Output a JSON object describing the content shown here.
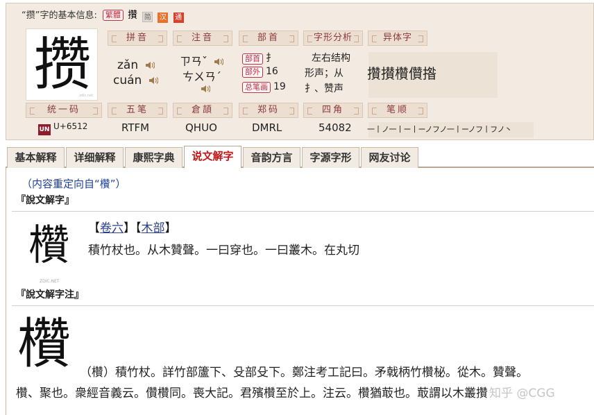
{
  "info": {
    "title_prefix": "“攒”字的基本信息:",
    "trad_tag": "繁體",
    "trad_char": "攢",
    "icon_grey": "简",
    "icon_orange": "汉",
    "icon_red": "通",
    "big_char": "攒",
    "big_char_watermark": "zdic.net"
  },
  "headers": {
    "pinyin": "拼音",
    "zhuyin": "注音",
    "bushou": "部首",
    "zixing": "字形分析",
    "yiti": "异体字",
    "tongyi": "统一码",
    "wubi": "五笔",
    "cangjie": "倉頡",
    "zhengma": "郑码",
    "sijiao": "四角",
    "bishun": "笔顺"
  },
  "values": {
    "pinyin_1": "zǎn",
    "pinyin_2": "cuán",
    "zhuyin_1": "ㄗㄢˇ",
    "zhuyin_2": "ㄘㄨㄢˊ",
    "bushou_label": "部首",
    "bushou_value": "扌",
    "buwai_label": "部外",
    "buwai_value": "16",
    "zongbihua_label": "总笔画",
    "zongbihua_value": "19",
    "zixing_1": "左右结构",
    "zixing_2": "形声；从",
    "zixing_3": "扌、赞声",
    "yiti": "攢攅欑儹揝",
    "unicode_logo": "UN",
    "unicode": "U+6512",
    "wubi": "RTFM",
    "cangjie": "QHUO",
    "zhengma": "DMRL",
    "sijiao": "54082",
    "bishun": "一丨ノ一丨ー丨ーノフノ一丨ーノフ丨フノ丶"
  },
  "tabs": [
    {
      "label": "基本解释"
    },
    {
      "label": "详细解释"
    },
    {
      "label": "康熙字典"
    },
    {
      "label": "说文解字",
      "active": true
    },
    {
      "label": "音韵方言"
    },
    {
      "label": "字源字形"
    },
    {
      "label": "网友讨论"
    }
  ],
  "content": {
    "redirect": "（内容重定向自“欑”）",
    "shuowen_title": "『說文解字』",
    "shuowen_glyph": "欑",
    "shuowen_glyph_watermark": "ZDIC.NET",
    "link_open": "【",
    "link_juan": "卷六",
    "link_mid": "】【",
    "link_mu": "木部",
    "link_close": "】",
    "shuowen_text": "積竹杖也。从木贊聲。一曰穿也。一曰叢木。在丸切",
    "zhu_title": "『說文解字注』",
    "zhu_glyph": "欑",
    "zhu_line1": "（欑）積竹杖。詳竹部籚下、殳部殳下。鄭注考工記曰。矛戟柄竹欑柲。從木。贊聲。",
    "zhu_line2": "欑、聚也。衆經音義云。儹欑同。喪大記。君殯欑至於上。注云。欑猶菆也。菆謂以木叢攢",
    "watermark": "知乎 @CGG"
  }
}
